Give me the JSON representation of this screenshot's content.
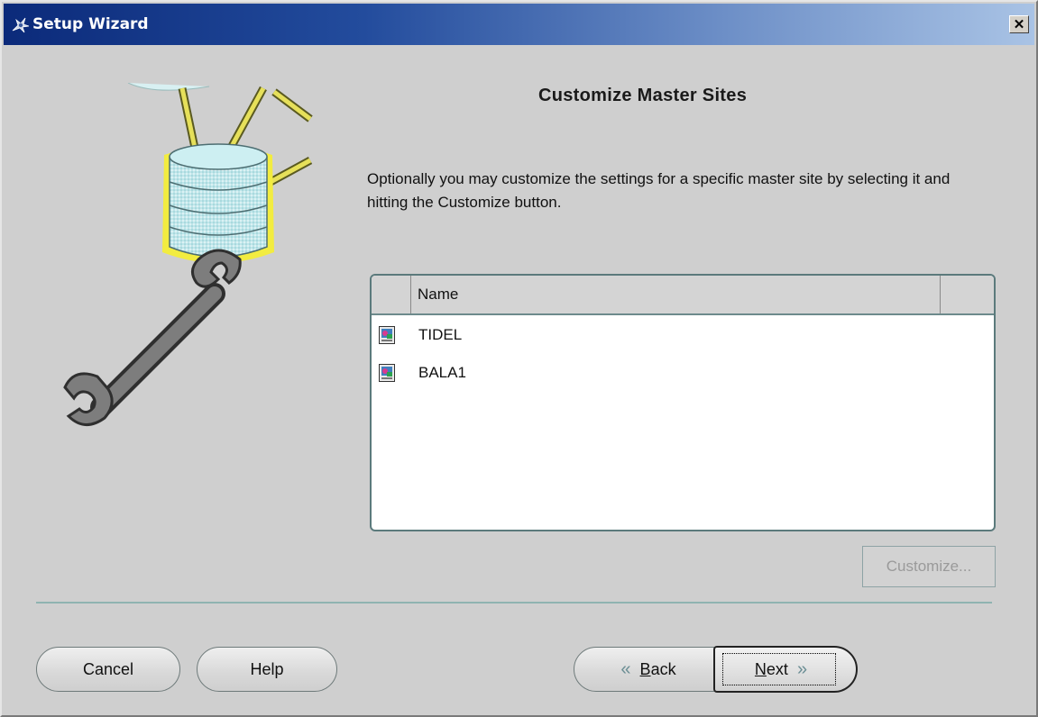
{
  "window": {
    "title": "Setup Wizard",
    "close_label": "✕"
  },
  "page": {
    "heading": "Customize Master Sites",
    "description": "Optionally you may customize the settings for a specific master site by selecting it and hitting the Customize button."
  },
  "list": {
    "column_header": "Name",
    "rows": [
      {
        "name": "TIDEL",
        "icon": "master-site-icon"
      },
      {
        "name": "BALA1",
        "icon": "master-site-icon"
      }
    ]
  },
  "buttons": {
    "customize": "Customize...",
    "cancel": "Cancel",
    "help": "Help",
    "back_mnemonic": "B",
    "back_rest": "ack",
    "next_mnemonic": "N",
    "next_rest": "ext"
  },
  "colors": {
    "titlebar_start": "#0b2a7a",
    "titlebar_end": "#a9c3e5",
    "dialog_bg": "#cfcfcf",
    "accent_teal": "#8fb3b1"
  }
}
